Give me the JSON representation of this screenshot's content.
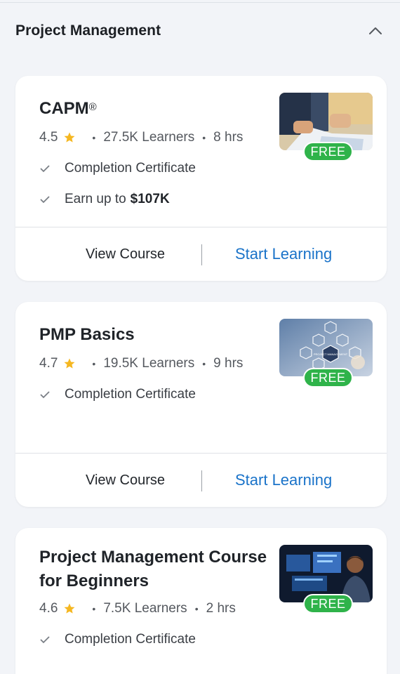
{
  "section": {
    "title": "Project Management",
    "expanded": true
  },
  "colors": {
    "accent": "#1a73c9",
    "free_badge": "#2fb34a",
    "star": "#f5b721",
    "background": "#f2f4f8"
  },
  "icons": {
    "star": "star-icon",
    "check": "check-icon",
    "chevron": "chevron-up-icon"
  },
  "courses": [
    {
      "title_line1": "CAPM",
      "title_mark": "®",
      "title_line2": "",
      "rating": "4.5",
      "learners": "27.5K Learners",
      "duration": "8 hrs",
      "benefits": [
        "Completion Certificate",
        "Earn up to"
      ],
      "benefit_highlight": "$107K",
      "badge": "FREE",
      "view_label": "View Course",
      "start_label": "Start Learning"
    },
    {
      "title_line1": "PMP Basics",
      "title_mark": "",
      "title_line2": "",
      "rating": "4.7",
      "learners": "19.5K Learners",
      "duration": "9 hrs",
      "benefits": [
        "Completion Certificate"
      ],
      "badge": "FREE",
      "thumb_text": "PROJECT MANAGEMENT",
      "view_label": "View Course",
      "start_label": "Start Learning"
    },
    {
      "title_line1": "Project Management Course",
      "title_mark": "",
      "title_line2": "for Beginners",
      "rating": "4.6",
      "learners": "7.5K Learners",
      "duration": "2 hrs",
      "benefits": [
        "Completion Certificate"
      ],
      "badge": "FREE"
    }
  ]
}
